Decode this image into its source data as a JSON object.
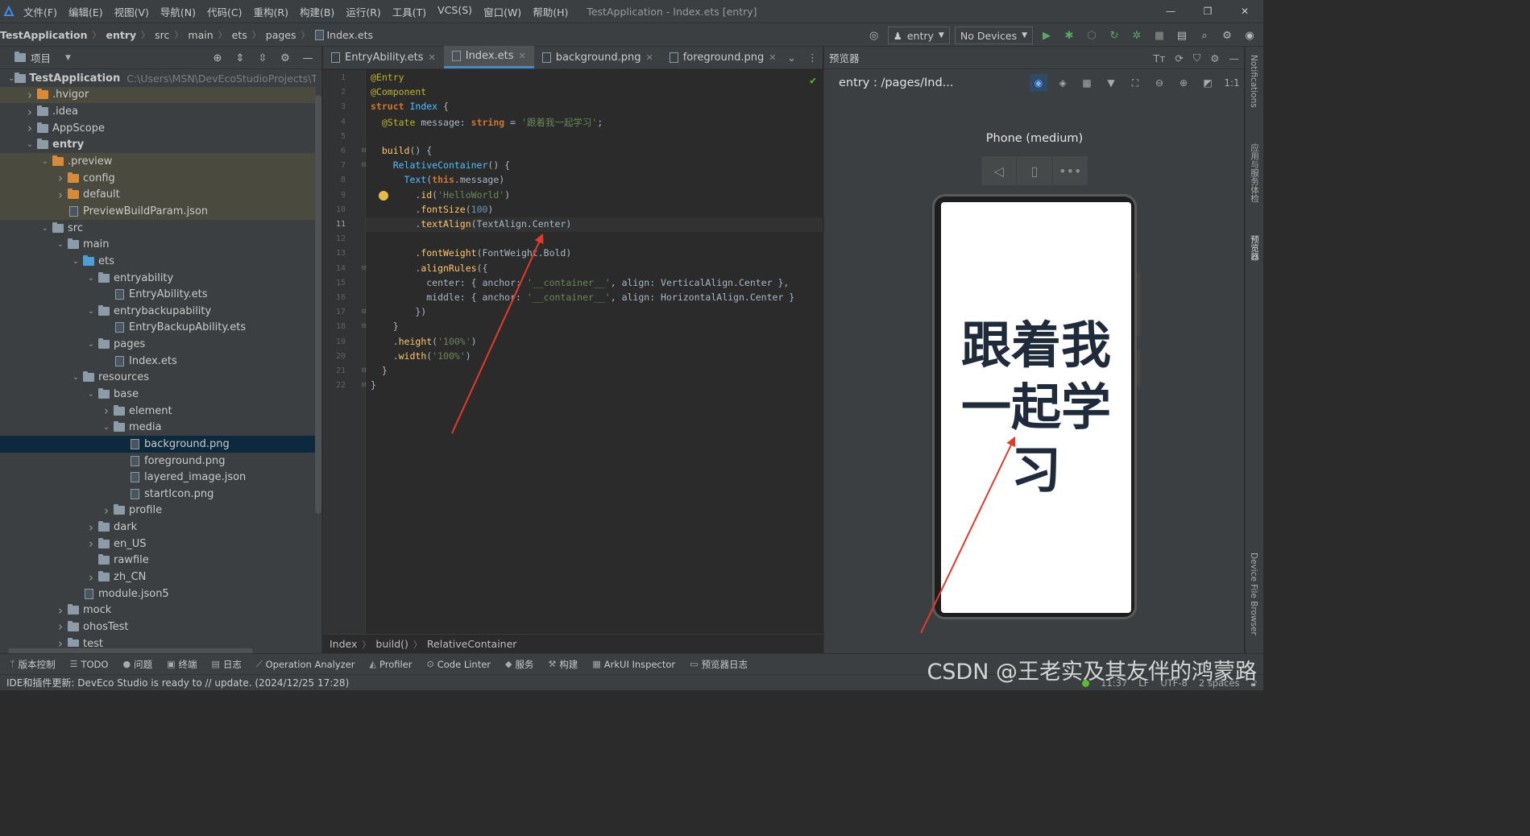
{
  "menubar": {
    "items": [
      "文件(F)",
      "编辑(E)",
      "视图(V)",
      "导航(N)",
      "代码(C)",
      "重构(R)",
      "构建(B)",
      "运行(R)",
      "工具(T)",
      "VCS(S)",
      "窗口(W)",
      "帮助(H)"
    ],
    "title": "TestApplication - Index.ets [entry]"
  },
  "navbar": {
    "crumbs": [
      "TestApplication",
      "entry",
      "src",
      "main",
      "ets",
      "pages",
      "Index.ets"
    ],
    "run_config": "entry",
    "device": "No Devices"
  },
  "project": {
    "title": "项目",
    "tree": [
      {
        "depth": 0,
        "label": "TestApplication",
        "path": "C:\\Users\\MSN\\DevEcoStudioProjects\\Tes",
        "arrow": "open",
        "icon": "folder",
        "bold": true
      },
      {
        "depth": 1,
        "label": ".hvigor",
        "arrow": "closed",
        "icon": "folder-orange",
        "hl": true
      },
      {
        "depth": 1,
        "label": ".idea",
        "arrow": "closed",
        "icon": "folder"
      },
      {
        "depth": 1,
        "label": "AppScope",
        "arrow": "closed",
        "icon": "folder"
      },
      {
        "depth": 1,
        "label": "entry",
        "arrow": "open",
        "icon": "folder",
        "bold": true
      },
      {
        "depth": 2,
        "label": ".preview",
        "arrow": "open",
        "icon": "folder-orange",
        "hl": true
      },
      {
        "depth": 3,
        "label": "config",
        "arrow": "closed",
        "icon": "folder-orange",
        "hl": true
      },
      {
        "depth": 3,
        "label": "default",
        "arrow": "closed",
        "icon": "folder-orange",
        "hl": true
      },
      {
        "depth": 3,
        "label": "PreviewBuildParam.json",
        "arrow": "none",
        "icon": "file",
        "hl": true
      },
      {
        "depth": 2,
        "label": "src",
        "arrow": "open",
        "icon": "folder"
      },
      {
        "depth": 3,
        "label": "main",
        "arrow": "open",
        "icon": "folder"
      },
      {
        "depth": 4,
        "label": "ets",
        "arrow": "open",
        "icon": "folder-blue"
      },
      {
        "depth": 5,
        "label": "entryability",
        "arrow": "open",
        "icon": "folder"
      },
      {
        "depth": 6,
        "label": "EntryAbility.ets",
        "arrow": "none",
        "icon": "file"
      },
      {
        "depth": 5,
        "label": "entrybackupability",
        "arrow": "open",
        "icon": "folder"
      },
      {
        "depth": 6,
        "label": "EntryBackupAbility.ets",
        "arrow": "none",
        "icon": "file"
      },
      {
        "depth": 5,
        "label": "pages",
        "arrow": "open",
        "icon": "folder"
      },
      {
        "depth": 6,
        "label": "Index.ets",
        "arrow": "none",
        "icon": "file"
      },
      {
        "depth": 4,
        "label": "resources",
        "arrow": "open",
        "icon": "folder"
      },
      {
        "depth": 5,
        "label": "base",
        "arrow": "open",
        "icon": "folder"
      },
      {
        "depth": 6,
        "label": "element",
        "arrow": "closed",
        "icon": "folder"
      },
      {
        "depth": 6,
        "label": "media",
        "arrow": "open",
        "icon": "folder"
      },
      {
        "depth": 7,
        "label": "background.png",
        "arrow": "none",
        "icon": "file",
        "sel": true
      },
      {
        "depth": 7,
        "label": "foreground.png",
        "arrow": "none",
        "icon": "file"
      },
      {
        "depth": 7,
        "label": "layered_image.json",
        "arrow": "none",
        "icon": "file"
      },
      {
        "depth": 7,
        "label": "startIcon.png",
        "arrow": "none",
        "icon": "file"
      },
      {
        "depth": 6,
        "label": "profile",
        "arrow": "closed",
        "icon": "folder"
      },
      {
        "depth": 5,
        "label": "dark",
        "arrow": "closed",
        "icon": "folder"
      },
      {
        "depth": 5,
        "label": "en_US",
        "arrow": "closed",
        "icon": "folder"
      },
      {
        "depth": 5,
        "label": "rawfile",
        "arrow": "none",
        "icon": "folder"
      },
      {
        "depth": 5,
        "label": "zh_CN",
        "arrow": "closed",
        "icon": "folder"
      },
      {
        "depth": 4,
        "label": "module.json5",
        "arrow": "none",
        "icon": "file"
      },
      {
        "depth": 3,
        "label": "mock",
        "arrow": "closed",
        "icon": "folder"
      },
      {
        "depth": 3,
        "label": "ohosTest",
        "arrow": "closed",
        "icon": "folder"
      },
      {
        "depth": 3,
        "label": "test",
        "arrow": "closed",
        "icon": "folder"
      }
    ]
  },
  "editor": {
    "tabs": [
      {
        "label": "EntryAbility.ets",
        "active": false
      },
      {
        "label": "Index.ets",
        "active": true
      },
      {
        "label": "background.png",
        "active": false
      },
      {
        "label": "foreground.png",
        "active": false
      }
    ],
    "current_line": 11,
    "bulb_line": 9,
    "fold_lines": [
      6,
      7,
      14,
      17,
      18,
      21,
      22
    ],
    "lines": [
      [
        [
          "an",
          "@Entry"
        ]
      ],
      [
        [
          "an",
          "@Component"
        ]
      ],
      [
        [
          "kw",
          "struct "
        ],
        [
          "ty",
          "Index"
        ],
        [
          "",
          " {"
        ]
      ],
      [
        [
          "",
          "  "
        ],
        [
          "an",
          "@State "
        ],
        [
          "",
          "message: "
        ],
        [
          "kw",
          "string"
        ],
        [
          "",
          " = "
        ],
        [
          "str",
          "'跟着我一起学习'"
        ],
        [
          "",
          ";"
        ]
      ],
      [],
      [
        [
          "",
          "  "
        ],
        [
          "fn",
          "build"
        ],
        [
          "",
          "() {"
        ]
      ],
      [
        [
          "",
          "    "
        ],
        [
          "ty",
          "RelativeContainer"
        ],
        [
          "",
          "() {"
        ]
      ],
      [
        [
          "",
          "      "
        ],
        [
          "ty",
          "Text"
        ],
        [
          "",
          "("
        ],
        [
          "kw",
          "this"
        ],
        [
          "",
          ".message)"
        ]
      ],
      [
        [
          "",
          "        ."
        ],
        [
          "fn",
          "id"
        ],
        [
          "",
          "("
        ],
        [
          "str",
          "'HelloWorld'"
        ],
        [
          "",
          ")"
        ]
      ],
      [
        [
          "",
          "        ."
        ],
        [
          "fn",
          "fontSize"
        ],
        [
          "",
          "("
        ],
        [
          "num",
          "100"
        ],
        [
          "",
          ")"
        ]
      ],
      [
        [
          "",
          "        ."
        ],
        [
          "fn",
          "textAlign"
        ],
        [
          "",
          "(TextAlign.Center)"
        ]
      ],
      [],
      [
        [
          "",
          "        ."
        ],
        [
          "fn",
          "fontWeight"
        ],
        [
          "",
          "(FontWeight.Bold)"
        ]
      ],
      [
        [
          "",
          "        ."
        ],
        [
          "fn",
          "alignRules"
        ],
        [
          "",
          "({"
        ]
      ],
      [
        [
          "",
          "          center: { anchor: "
        ],
        [
          "str",
          "'__container__'"
        ],
        [
          "",
          ", align: VerticalAlign.Center },"
        ]
      ],
      [
        [
          "",
          "          middle: { anchor: "
        ],
        [
          "str",
          "'__container__'"
        ],
        [
          "",
          ", align: HorizontalAlign.Center }"
        ]
      ],
      [
        [
          "",
          "        })"
        ]
      ],
      [
        [
          "",
          "    }"
        ]
      ],
      [
        [
          "",
          "    ."
        ],
        [
          "fn",
          "height"
        ],
        [
          "",
          "("
        ],
        [
          "str",
          "'100%'"
        ],
        [
          "",
          ")"
        ]
      ],
      [
        [
          "",
          "    ."
        ],
        [
          "fn",
          "width"
        ],
        [
          "",
          "("
        ],
        [
          "str",
          "'100%'"
        ],
        [
          "",
          ")"
        ]
      ],
      [
        [
          "",
          "  }"
        ]
      ],
      [
        [
          "",
          "}"
        ]
      ]
    ],
    "breadcrumbs": [
      "Index",
      "build()",
      "RelativeContainer"
    ]
  },
  "previewer": {
    "panel_title": "预览器",
    "page_path": "entry : /pages/Ind...",
    "device_name": "Phone (medium)",
    "message": "跟着我一起学习"
  },
  "right_strip": [
    "Notifications",
    "应用与服务体检",
    "预览器",
    "Device File Browser"
  ],
  "toolwindows": [
    {
      "icon": "ᛘ",
      "label": "版本控制"
    },
    {
      "icon": "☰",
      "label": "TODO"
    },
    {
      "icon": "●",
      "label": "问题"
    },
    {
      "icon": "▣",
      "label": "终端"
    },
    {
      "icon": "▤",
      "label": "日志"
    },
    {
      "icon": "⟋",
      "label": "Operation Analyzer"
    },
    {
      "icon": "◭",
      "label": "Profiler"
    },
    {
      "icon": "⊙",
      "label": "Code Linter"
    },
    {
      "icon": "◆",
      "label": "服务"
    },
    {
      "icon": "⚒",
      "label": "构建"
    },
    {
      "icon": "▦",
      "label": "ArkUI Inspector"
    },
    {
      "icon": "▭",
      "label": "预览器日志"
    }
  ],
  "statusbar": {
    "message": "IDE和插件更新: DevEco Studio is ready to // update. (2024/12/25 17:28)",
    "time": "11:37",
    "line_sep": "LF",
    "encoding": "UTF-8",
    "indent": "2 spaces"
  },
  "watermark": "CSDN @王老实及其友伴的鸿蒙路",
  "colors": {
    "accent": "#4a88c7",
    "selection": "#0d293e",
    "annotation_arrow": "#e53a2b"
  }
}
